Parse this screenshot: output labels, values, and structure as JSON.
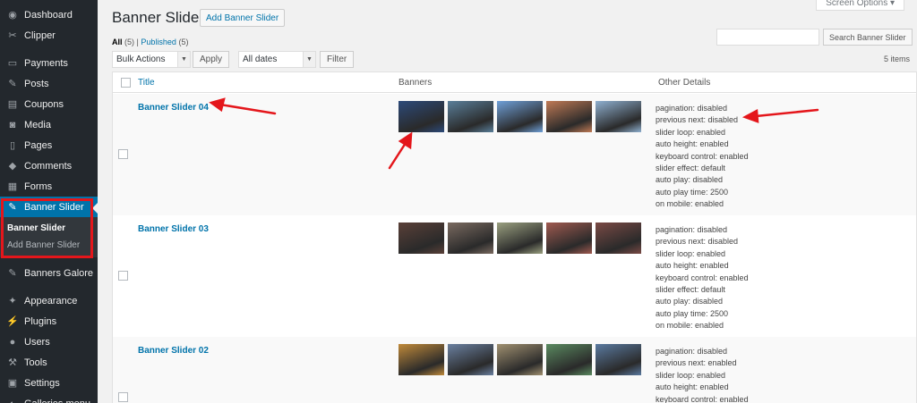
{
  "sidebar": {
    "items": [
      {
        "label": "Dashboard",
        "icon": "dashboard-icon"
      },
      {
        "label": "Clipper",
        "icon": "clipper-icon"
      },
      {
        "sep": true
      },
      {
        "label": "Payments",
        "icon": "payments-icon"
      },
      {
        "label": "Posts",
        "icon": "pin-icon"
      },
      {
        "label": "Coupons",
        "icon": "coupons-icon"
      },
      {
        "label": "Media",
        "icon": "media-icon"
      },
      {
        "label": "Pages",
        "icon": "pages-icon"
      },
      {
        "label": "Comments",
        "icon": "comments-icon"
      },
      {
        "label": "Forms",
        "icon": "forms-icon"
      }
    ],
    "current": {
      "label": "Banner Slider",
      "icon": "pin-icon"
    },
    "submenu": [
      {
        "label": "Banner Slider",
        "active": true
      },
      {
        "label": "Add Banner Slider",
        "active": false
      }
    ],
    "items_after": [
      {
        "label": "Banners Galore",
        "icon": "pin-icon"
      },
      {
        "sep": true
      },
      {
        "label": "Appearance",
        "icon": "appearance-icon"
      },
      {
        "label": "Plugins",
        "icon": "plugins-icon"
      },
      {
        "label": "Users",
        "icon": "users-icon"
      },
      {
        "label": "Tools",
        "icon": "tools-icon"
      },
      {
        "label": "Settings",
        "icon": "settings-icon"
      },
      {
        "label": "Galleries menu",
        "icon": "galleries-icon"
      }
    ]
  },
  "header": {
    "title": "Banner Slider",
    "add_button": "Add Banner Slider",
    "screen_options": "Screen Options ▾"
  },
  "filters": {
    "all_label": "All",
    "all_count": "(5)",
    "separator": "|",
    "published_label": "Published",
    "published_count": "(5)",
    "search_button": "Search Banner Slider",
    "bulk_actions": "Bulk Actions",
    "apply": "Apply",
    "all_dates": "All dates",
    "filter": "Filter",
    "items_count": "5 items"
  },
  "table": {
    "columns": {
      "title": "Title",
      "banners": "Banners",
      "details": "Other Details"
    },
    "rows": [
      {
        "title": "Banner Slider 04",
        "thumbs": [
          "#2c4a7a",
          "#5a7f9a",
          "#6fa0d8",
          "#c07a55",
          "#8fb0d0"
        ],
        "details": [
          "pagination: disabled",
          "previous next: disabled",
          "slider loop: enabled",
          "auto height: enabled",
          "keyboard control: enabled",
          "slider effect: default",
          "auto play: disabled",
          "auto play time: 2500",
          "on mobile: enabled"
        ]
      },
      {
        "title": "Banner Slider 03",
        "thumbs": [
          "#5a4038",
          "#7a6a60",
          "#9aa080",
          "#a05a50",
          "#7a4a45"
        ],
        "details": [
          "pagination: disabled",
          "previous next: disabled",
          "slider loop: enabled",
          "auto height: enabled",
          "keyboard control: enabled",
          "slider effect: default",
          "auto play: disabled",
          "auto play time: 2500",
          "on mobile: enabled"
        ]
      },
      {
        "title": "Banner Slider 02",
        "thumbs": [
          "#c08a3a",
          "#6a80a0",
          "#a09070",
          "#5a8a60",
          "#5a7aa0"
        ],
        "details": [
          "pagination: disabled",
          "previous next: enabled",
          "slider loop: enabled",
          "auto height: enabled",
          "keyboard control: enabled"
        ]
      }
    ]
  },
  "colors": {
    "sidebar_bg": "#23282d",
    "accent": "#0073aa",
    "annotation": "#e4161b"
  }
}
